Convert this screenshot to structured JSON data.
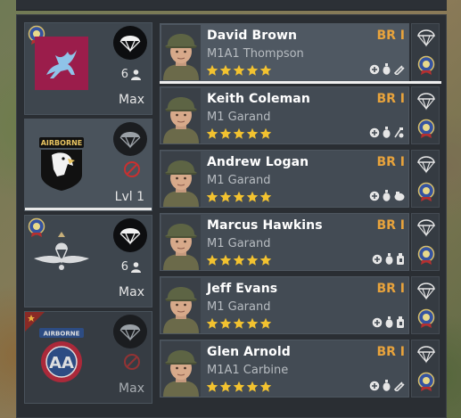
{
  "squads": [
    {
      "name": "pegasus-squad",
      "count": "6",
      "level": "Max",
      "has_medal": true,
      "locked": false
    },
    {
      "name": "airborne-101-squad",
      "count": "",
      "level": "Lvl 1",
      "has_medal": false,
      "locked": true
    },
    {
      "name": "parachute-regiment-squad",
      "count": "6",
      "level": "Max",
      "has_medal": true,
      "locked": false
    },
    {
      "name": "airborne-82-squad",
      "count": "",
      "level": "Max",
      "has_medal": false,
      "locked": true
    }
  ],
  "soldiers": [
    {
      "name": "David Brown",
      "weapon": "M1A1 Thompson",
      "rank": "BR I",
      "stars": 5
    },
    {
      "name": "Keith Coleman",
      "weapon": "M1 Garand",
      "rank": "BR I",
      "stars": 5
    },
    {
      "name": "Andrew Logan",
      "weapon": "M1 Garand",
      "rank": "BR I",
      "stars": 5
    },
    {
      "name": "Marcus Hawkins",
      "weapon": "M1 Garand",
      "rank": "BR I",
      "stars": 5
    },
    {
      "name": "Jeff Evans",
      "weapon": "M1 Garand",
      "rank": "BR I",
      "stars": 5
    },
    {
      "name": "Glen Arnold",
      "weapon": "M1A1 Carbine",
      "rank": "BR I",
      "stars": 5
    }
  ],
  "emblem_text": {
    "airborne_101": "AIRBORNE",
    "airborne_82": "AIRBORNE",
    "aa": "AA"
  },
  "colors": {
    "rank": "#e8a33c",
    "star": "#f2c230",
    "selected_line": "#efefef"
  }
}
